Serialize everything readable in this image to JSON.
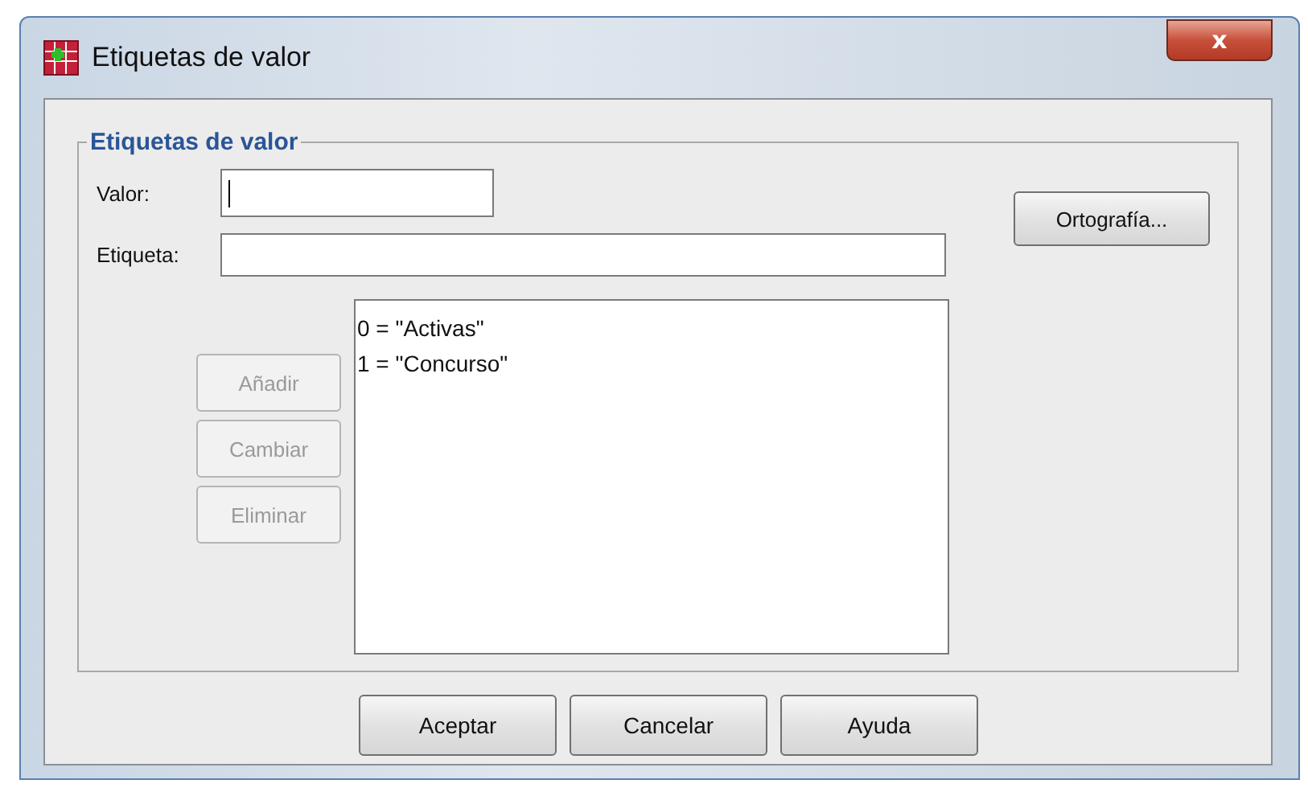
{
  "window": {
    "title": "Etiquetas de valor",
    "close": "x"
  },
  "group": {
    "title": "Etiquetas de valor"
  },
  "fields": [
    {
      "label": "Valor:",
      "focused": true
    },
    {
      "label": "Etiqueta:",
      "focused": false
    }
  ],
  "spelling_button": {
    "label": "Ortografía...",
    "disabled": false
  },
  "side_buttons": [
    {
      "label": "Añadir",
      "disabled": true
    },
    {
      "label": "Cambiar",
      "disabled": true
    },
    {
      "label": "Eliminar",
      "disabled": true
    }
  ],
  "list": [
    "0 = \"Activas\"",
    "1 = \"Concurso\""
  ],
  "buttons": [
    "Aceptar",
    "Cancelar",
    "Ayuda"
  ]
}
